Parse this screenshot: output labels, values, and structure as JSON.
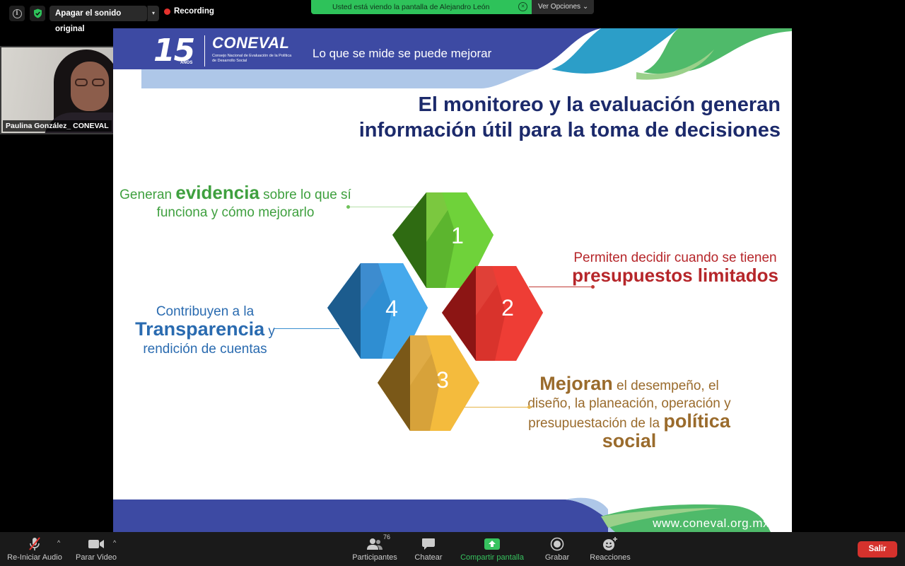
{
  "topbar": {
    "audio_button": "Apagar el sonido original",
    "recording": "Recording",
    "viewing_banner": "Usted está viendo la pantalla de Alejandro León",
    "view_options": "Ver Opciones ⌄"
  },
  "thumbnail": {
    "name": "Paulina González_ CONEVAL"
  },
  "slide": {
    "logo_number": "15",
    "logo_anios": "AÑOS",
    "logo_name": "CONEVAL",
    "logo_subtitle": "Consejo Nacional de Evaluación de la Política de Desarrollo Social",
    "slogan": "Lo que se mide se puede mejorar",
    "title_line1": "El monitoreo y la evaluación generan",
    "title_line2": "información útil para la toma de decisiones",
    "item1": {
      "pre": "Generan ",
      "bold": "evidencia",
      "post": " sobre lo que sí funciona y cómo mejorarlo"
    },
    "item2": {
      "pre": "Permiten decidir cuando se tienen ",
      "bold": "presupuestos limitados"
    },
    "item3": {
      "pre": "Contribuyen a la ",
      "bold": "Transparencia",
      "post": " y rendición de cuentas"
    },
    "item4": {
      "bold1": "Mejoran",
      "mid": " el desempeño, el diseño, la planeación, operación y presupuestación de la ",
      "bold2": "política social"
    },
    "cube_numbers": [
      "1",
      "2",
      "3",
      "4"
    ],
    "url": "www.coneval.org.mx",
    "colors": {
      "navy": "#1c2a6b",
      "green": "#3fa03f",
      "red": "#b6262a",
      "blue": "#2a6bb0",
      "brown": "#9a6b2c"
    }
  },
  "toolbar": {
    "audio": "Re-Iniciar Audio",
    "video": "Parar Video",
    "participants": "Participantes",
    "participants_count": "76",
    "chat": "Chatear",
    "share": "Compartir pantalla",
    "record": "Grabar",
    "reactions": "Reacciones",
    "leave": "Salir"
  }
}
